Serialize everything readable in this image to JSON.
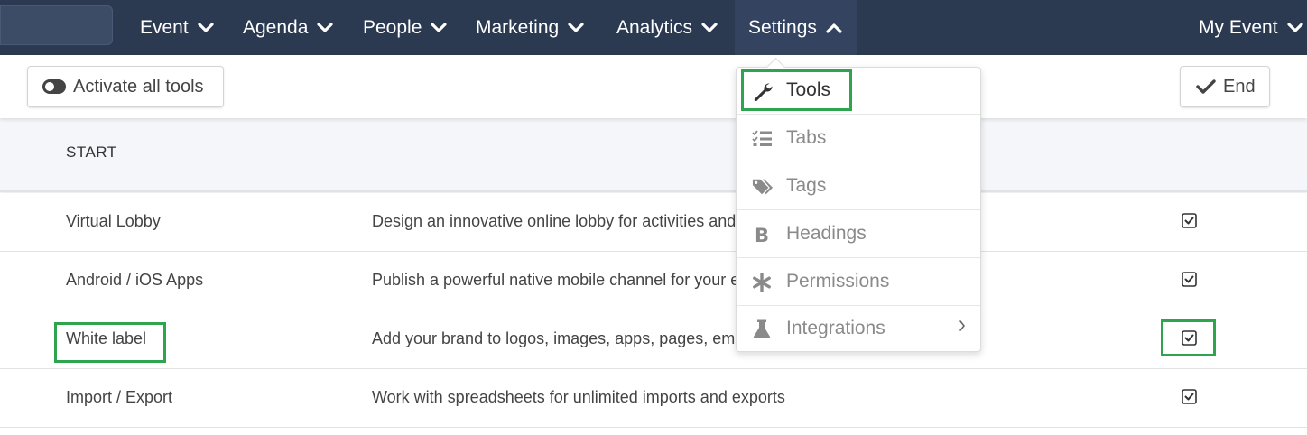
{
  "nav": {
    "items": [
      {
        "label": "Event"
      },
      {
        "label": "Agenda"
      },
      {
        "label": "People"
      },
      {
        "label": "Marketing"
      },
      {
        "label": "Analytics"
      },
      {
        "label": "Settings"
      }
    ],
    "account_label": "My Event"
  },
  "toolbar": {
    "activate_label": "Activate all tools",
    "end_label": "End"
  },
  "table": {
    "header_start": "START",
    "rows": [
      {
        "name": "Virtual Lobby",
        "description": "Design an innovative online lobby for activities and",
        "checked": true
      },
      {
        "name": "Android / iOS Apps",
        "description": "Publish a powerful native mobile channel for your e",
        "checked": true
      },
      {
        "name": "White label",
        "description": "Add your brand to logos, images, apps, pages, email",
        "checked": true
      },
      {
        "name": "Import / Export",
        "description": "Work with spreadsheets for unlimited imports and exports",
        "checked": true
      }
    ]
  },
  "settings_menu": {
    "items": [
      {
        "label": "Tools",
        "icon": "wrench-icon"
      },
      {
        "label": "Tabs",
        "icon": "list-check-icon"
      },
      {
        "label": "Tags",
        "icon": "tags-icon"
      },
      {
        "label": "Headings",
        "icon": "bold-icon"
      },
      {
        "label": "Permissions",
        "icon": "asterisk-icon"
      },
      {
        "label": "Integrations",
        "icon": "flask-icon"
      }
    ]
  },
  "colors": {
    "nav_bg": "#2b3951",
    "highlight": "#2ea44f"
  }
}
